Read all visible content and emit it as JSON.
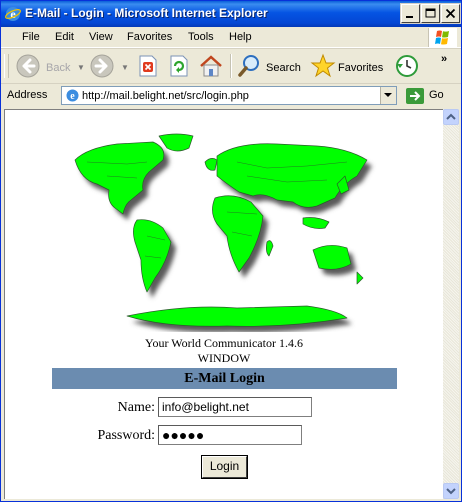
{
  "window": {
    "title": "E-Mail - Login - Microsoft Internet Explorer"
  },
  "menu": {
    "items": [
      "File",
      "Edit",
      "View",
      "Favorites",
      "Tools",
      "Help"
    ]
  },
  "toolbar": {
    "back_label": "Back",
    "search_label": "Search",
    "favorites_label": "Favorites"
  },
  "address": {
    "label": "Address",
    "url": "http://mail.belight.net/src/login.php",
    "go_label": "Go"
  },
  "page": {
    "tagline": "Your World Communicator 1.4.6",
    "subtagline": "WINDOW",
    "login_header": "E-Mail Login",
    "name_label": "Name:",
    "name_value": "info@belight.net",
    "password_label": "Password:",
    "password_mask": "●●●●●",
    "login_button": "Login"
  },
  "colors": {
    "map_land": "#00ff00",
    "header_band": "#6b8cb0",
    "titlebar": "#0554e3"
  },
  "icons": [
    "ie-icon",
    "minimize-icon",
    "maximize-icon",
    "close-icon",
    "back-icon",
    "forward-icon",
    "stop-icon",
    "refresh-icon",
    "home-icon",
    "search-icon",
    "favorites-icon",
    "history-icon",
    "go-icon",
    "windows-logo-icon"
  ]
}
